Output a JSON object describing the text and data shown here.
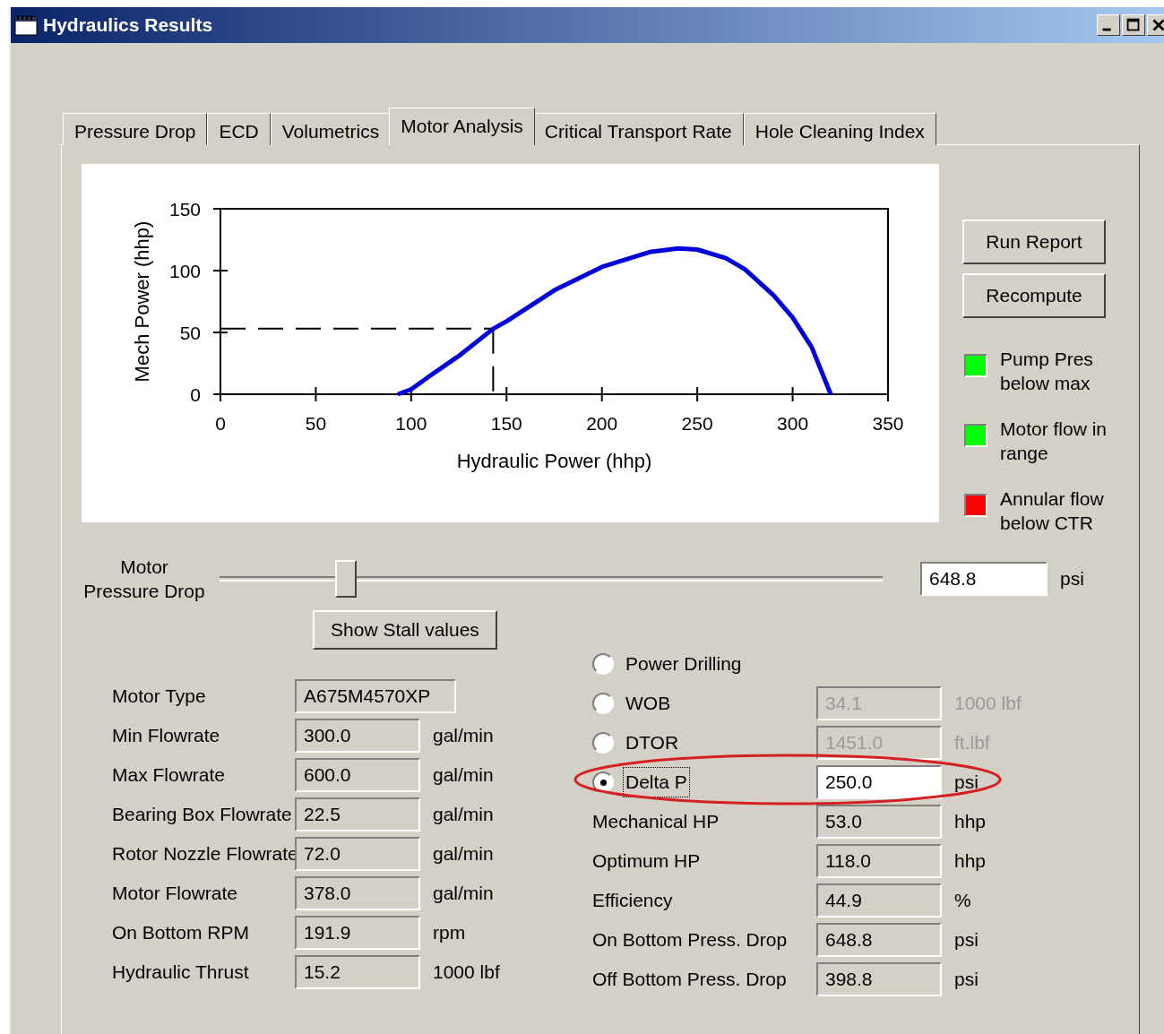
{
  "window": {
    "title": "Hydraulics Results"
  },
  "tabs": [
    {
      "label": "Pressure Drop",
      "selected": false
    },
    {
      "label": "ECD",
      "selected": false
    },
    {
      "label": "Volumetrics",
      "selected": false
    },
    {
      "label": "Motor Analysis",
      "selected": true
    },
    {
      "label": "Critical Transport Rate",
      "selected": false
    },
    {
      "label": "Hole Cleaning Index",
      "selected": false
    }
  ],
  "chart": {
    "chart_data": {
      "type": "line",
      "xlabel": "Hydraulic Power (hhp)",
      "ylabel": "Mech Power (hhp)",
      "xlim": [
        0,
        350
      ],
      "ylim": [
        0,
        150
      ],
      "xticks": [
        0,
        50,
        100,
        150,
        200,
        250,
        300,
        350
      ],
      "yticks": [
        0,
        50,
        100,
        150
      ],
      "x": [
        93,
        100,
        110,
        125,
        143,
        150,
        175,
        200,
        225,
        240,
        250,
        265,
        275,
        290,
        300,
        310,
        320
      ],
      "series": [
        {
          "color": "#0000dd",
          "values": [
            0,
            4,
            15,
            31,
            53,
            59,
            84,
            103,
            115,
            118,
            117,
            110,
            101,
            80,
            62,
            38,
            0
          ]
        }
      ],
      "ref_lines": [
        {
          "axis": "x",
          "value": 143
        },
        {
          "axis": "y",
          "value": 53
        }
      ]
    }
  },
  "buttons": [
    {
      "label": "Run Report"
    },
    {
      "label": "Recompute"
    }
  ],
  "indicators": [
    {
      "label": "Pump Pres below max",
      "color": "#00ff00"
    },
    {
      "label": "Motor flow in range",
      "color": "#00ff00"
    },
    {
      "label": "Annular flow below CTR",
      "color": "#ff0000"
    }
  ],
  "slider": {
    "label": "Motor Pressure Drop",
    "level": 0.19,
    "value": "648.8",
    "unit": "psi"
  },
  "stall_button": {
    "label": "Show Stall values"
  },
  "motor_fields": [
    {
      "label": "Motor Type",
      "value": "A675M4570XP"
    },
    {
      "label": "Min Flowrate",
      "value": "300.0",
      "unit": "gal/min"
    },
    {
      "label": "Max Flowrate",
      "value": "600.0",
      "unit": "gal/min"
    },
    {
      "label": "Bearing Box Flowrate",
      "value": "22.5",
      "unit": "gal/min"
    },
    {
      "label": "Rotor Nozzle Flowrate",
      "value": "72.0",
      "unit": "gal/min"
    },
    {
      "label": "Motor Flowrate",
      "value": "378.0",
      "unit": "gal/min"
    },
    {
      "label": "On Bottom RPM",
      "value": "191.9",
      "unit": "rpm"
    },
    {
      "label": "Hydraulic Thrust",
      "value": "15.2",
      "unit": "1000 lbf"
    }
  ],
  "modes": [
    {
      "label": "Power Drilling",
      "selected": false
    },
    {
      "label": "WOB",
      "selected": false,
      "value": "34.1",
      "unit": "1000 lbf",
      "disabled": true
    },
    {
      "label": "DTOR",
      "selected": false,
      "value": "1451.0",
      "unit": "ft.lbf",
      "disabled": true
    },
    {
      "label": "Delta P",
      "selected": true,
      "highlighted": true,
      "value": "250.0",
      "unit": "psi",
      "disabled": false
    }
  ],
  "results": [
    {
      "label": "Mechanical HP",
      "value": "53.0",
      "unit": "hhp"
    },
    {
      "label": "Optimum HP",
      "value": "118.0",
      "unit": "hhp"
    },
    {
      "label": "Efficiency",
      "value": "44.9",
      "unit": "%"
    },
    {
      "label": "On Bottom Press. Drop",
      "value": "648.8",
      "unit": "psi"
    },
    {
      "label": "Off Bottom Press. Drop",
      "value": "398.8",
      "unit": "psi"
    }
  ]
}
